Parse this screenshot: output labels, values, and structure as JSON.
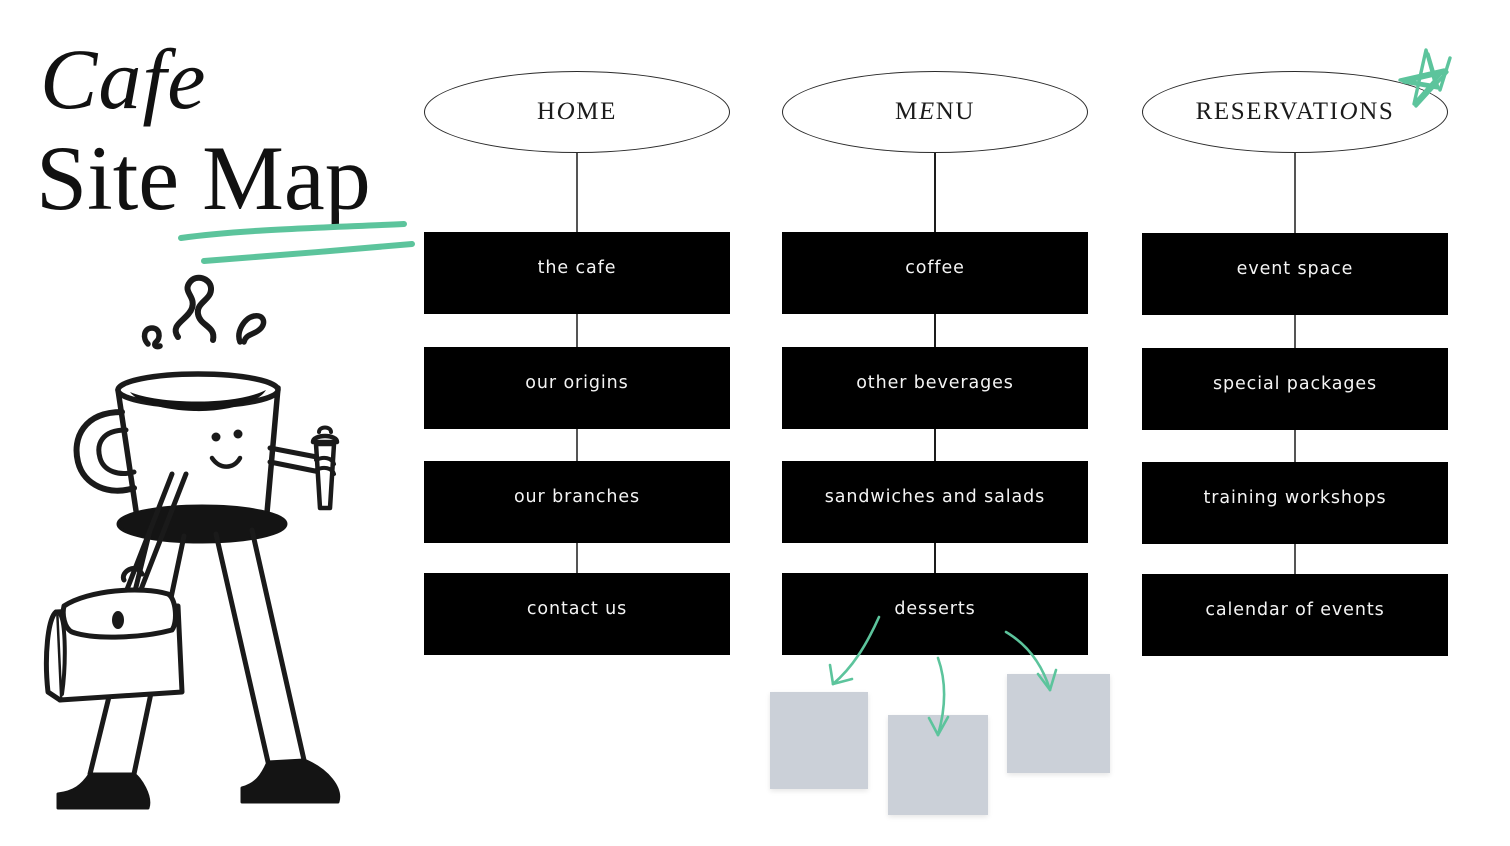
{
  "page": {
    "background": "#ffffff",
    "accent_green": "#5cc49c",
    "node_fill": "#000000",
    "node_text": "#f4f4f4",
    "placeholder_gray": "#cbd0d8",
    "line_color": "#555555"
  },
  "title": {
    "line1": "Cafe",
    "line2": "Site Map",
    "underline_color": "#5cc49c"
  },
  "illustration": {
    "name": "walking-coffee-cup-character",
    "description": "hand-drawn coffee cup with a face, steam, holding a takeaway cup, walking with a satchel"
  },
  "decorations": {
    "star": {
      "name": "star-doodle",
      "color": "#5cc49c"
    }
  },
  "columns": [
    {
      "id": "home",
      "header": {
        "text": "HOME",
        "pre": "H",
        "slant": "O",
        "post": "ME"
      },
      "nodes": [
        {
          "label": "the cafe"
        },
        {
          "label": "our origins"
        },
        {
          "label": "our branches"
        },
        {
          "label": "contact us"
        }
      ]
    },
    {
      "id": "menu",
      "header": {
        "text": "MENU",
        "pre": "M",
        "slant": "E",
        "post": "NU"
      },
      "nodes": [
        {
          "label": "coffee"
        },
        {
          "label": "other beverages"
        },
        {
          "label": "sandwiches and salads"
        },
        {
          "label": "desserts"
        }
      ]
    },
    {
      "id": "reservations",
      "header": {
        "text": "RESERVATIONS",
        "pre": "RESERVATI",
        "slant": "O",
        "post": "NS"
      },
      "nodes": [
        {
          "label": "event space"
        },
        {
          "label": "special packages"
        },
        {
          "label": "training workshops"
        },
        {
          "label": "calendar of events"
        }
      ]
    }
  ],
  "dessert_placeholders": [
    {
      "name": "dessert-image-placeholder-1"
    },
    {
      "name": "dessert-image-placeholder-2"
    },
    {
      "name": "dessert-image-placeholder-3"
    }
  ]
}
